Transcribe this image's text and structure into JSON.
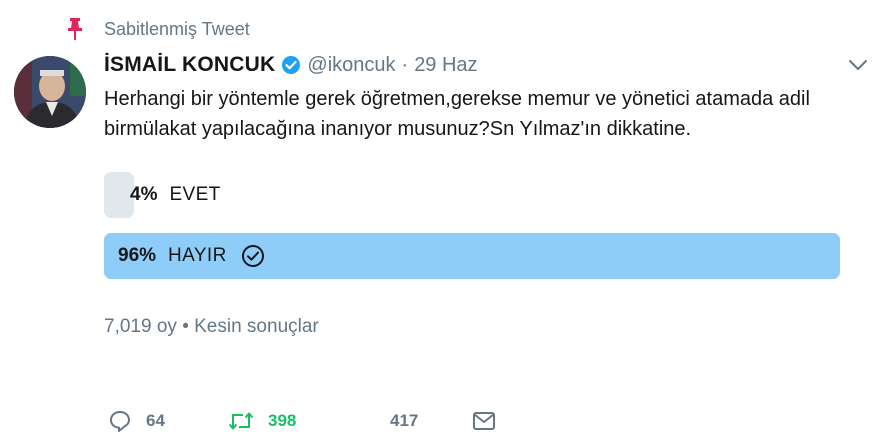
{
  "pinned": {
    "label": "Sabitlenmiş Tweet",
    "icon": "pin-icon",
    "color": "#e0245e"
  },
  "author": {
    "name": "İSMAİL KONCUK",
    "handle": "@ikoncuk",
    "separator": "·",
    "date": "29 Haz",
    "verified_icon": "verified-badge-icon",
    "verified_color": "#1da1f2"
  },
  "tweet": {
    "text": "Herhangi bir yöntemle gerek öğretmen,gerekse memur ve yönetici atamada adil birmülakat yapılacağına inanıyor musunuz?Sn Yılmaz'ın dikkatine."
  },
  "poll": {
    "options": [
      {
        "percent": "4%",
        "label": "EVET",
        "share": 0.04,
        "color": "#e1e8ed"
      },
      {
        "percent": "96%",
        "label": "HAYIR",
        "share": 0.96,
        "color": "#8ecdf8",
        "winner_icon": "check-circle-icon"
      }
    ],
    "votes": "7,019 oy",
    "dot": "•",
    "status": "Kesin sonuçlar"
  },
  "actions": {
    "reply": {
      "icon": "reply-icon",
      "count": "64"
    },
    "retweet": {
      "icon": "retweet-icon",
      "count": "398",
      "color": "#17bf63"
    },
    "like": {
      "icon": "like-icon",
      "count": "417"
    },
    "message": {
      "icon": "mail-icon"
    }
  },
  "menu": {
    "icon": "chevron-down-icon"
  }
}
